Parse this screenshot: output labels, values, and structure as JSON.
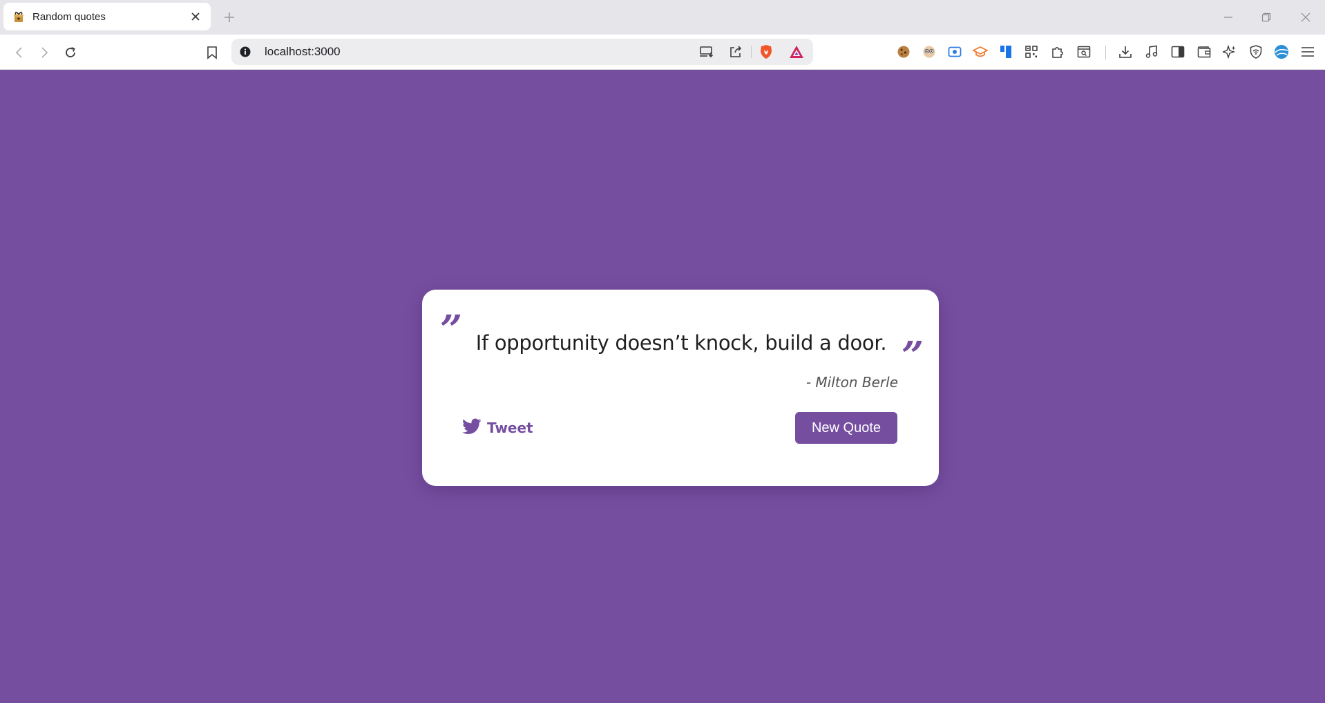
{
  "browser": {
    "tab": {
      "title": "Random quotes"
    },
    "address_bar": {
      "url": "localhost:3000"
    }
  },
  "page": {
    "background_color": "#764ea0",
    "accent_color": "#764ea0",
    "quote": {
      "open_mark": "”",
      "close_mark": "”",
      "text": "If opportunity doesn’t knock, build a door.",
      "author": "- Milton Berle"
    },
    "actions": {
      "tweet_label": "Tweet",
      "new_quote_label": "New Quote"
    }
  }
}
